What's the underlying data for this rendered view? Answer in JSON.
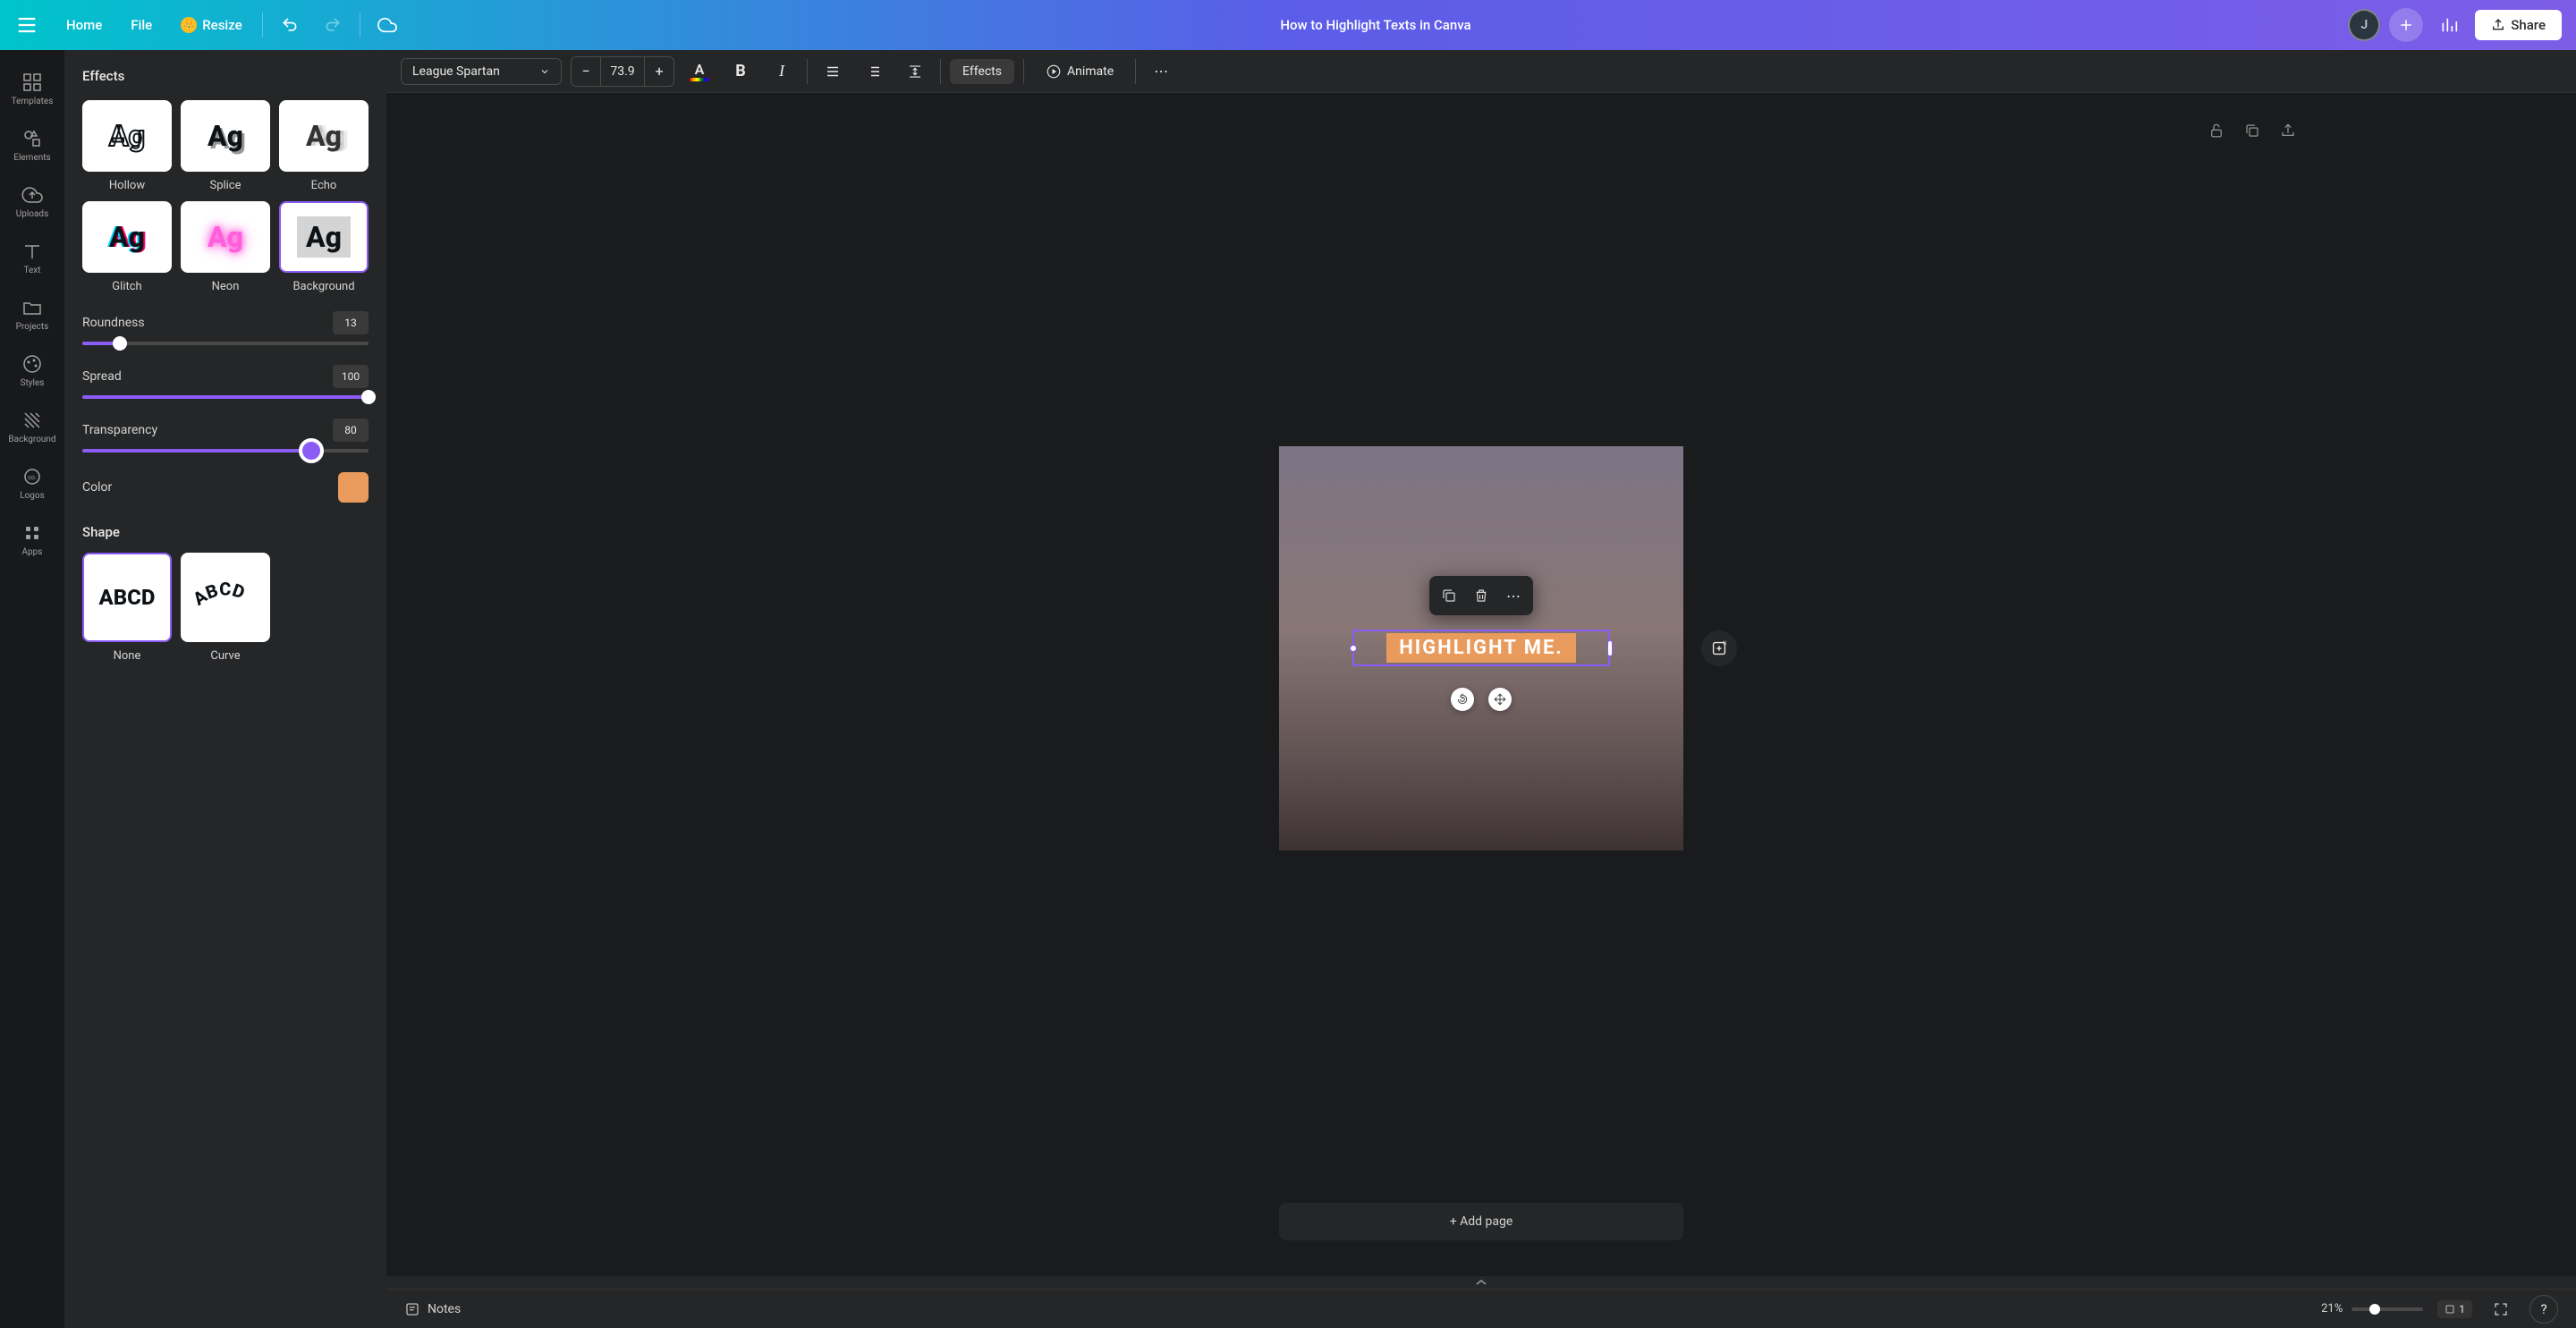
{
  "header": {
    "home": "Home",
    "file": "File",
    "resize": "Resize",
    "doc_title": "How to Highlight Texts in Canva",
    "avatar_initial": "J",
    "share": "Share"
  },
  "rail": {
    "templates": "Templates",
    "elements": "Elements",
    "uploads": "Uploads",
    "text": "Text",
    "projects": "Projects",
    "styles": "Styles",
    "background": "Background",
    "logos": "Logos",
    "apps": "Apps"
  },
  "panel": {
    "title": "Effects",
    "effects": {
      "hollow": "Hollow",
      "splice": "Splice",
      "echo": "Echo",
      "glitch": "Glitch",
      "neon": "Neon",
      "background": "Background"
    },
    "sample_text": "Ag",
    "roundness": {
      "label": "Roundness",
      "value": "13"
    },
    "spread": {
      "label": "Spread",
      "value": "100"
    },
    "transparency": {
      "label": "Transparency",
      "value": "80"
    },
    "color": {
      "label": "Color",
      "hex": "#e89b5c"
    },
    "shape": {
      "title": "Shape",
      "none": "None",
      "none_sample": "ABCD",
      "curve": "Curve",
      "curve_sample": "ABCD"
    }
  },
  "toolbar": {
    "font": "League Spartan",
    "font_size": "73.9",
    "effects": "Effects",
    "animate": "Animate"
  },
  "canvas": {
    "text_content": "HIGHLIGHT ME.",
    "highlight_color": "#e89b5c",
    "add_page": "+ Add page"
  },
  "bottom": {
    "notes": "Notes",
    "zoom": "21%",
    "page_num": "1"
  }
}
